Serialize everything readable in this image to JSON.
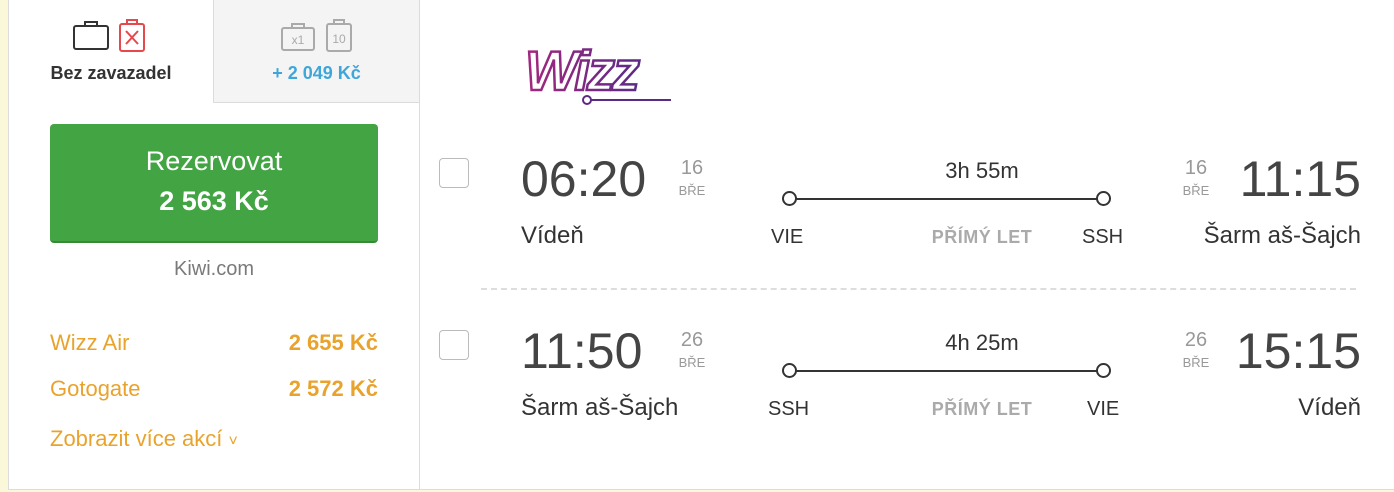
{
  "fare_tabs": [
    {
      "label": "Bez zavazadel"
    },
    {
      "price": "+ 2 049 Kč",
      "cabin_count": "x1",
      "checked_kg": "10"
    }
  ],
  "booking": {
    "button_title": "Rezervovat",
    "button_price": "2 563 Kč",
    "provider": "Kiwi.com"
  },
  "other_offers": [
    {
      "name": "Wizz Air",
      "price": "2 655 Kč"
    },
    {
      "name": "Gotogate",
      "price": "2 572 Kč"
    }
  ],
  "more_offers": "Zobrazit více akcí",
  "more_chevron": "˅",
  "airline_logo_text": "Wizz",
  "segments": [
    {
      "dep_time": "06:20",
      "dep_day": "16",
      "dep_month": "BŘE",
      "dep_city": "Vídeň",
      "dep_iata": "VIE",
      "duration": "3h 55m",
      "direct": "PŘÍMÝ LET",
      "arr_iata": "SSH",
      "arr_day": "16",
      "arr_month": "BŘE",
      "arr_time": "11:15",
      "arr_city": "Šarm aš-Šajch"
    },
    {
      "dep_time": "11:50",
      "dep_day": "26",
      "dep_month": "BŘE",
      "dep_city": "Šarm aš-Šajch",
      "dep_iata": "SSH",
      "duration": "4h 25m",
      "direct": "PŘÍMÝ LET",
      "arr_iata": "VIE",
      "arr_day": "26",
      "arr_month": "BŘE",
      "arr_time": "15:15",
      "arr_city": "Vídeň"
    }
  ],
  "colors": {
    "book_green": "#43a443",
    "offer_orange": "#e9a32c",
    "bag_price_blue": "#3fa6d9",
    "no_bag_red": "#e5484d",
    "logo_purple": "#8a2a8c"
  }
}
